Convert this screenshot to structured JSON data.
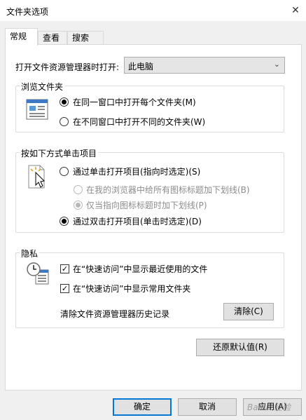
{
  "window": {
    "title": "文件夹选项",
    "close_glyph": "✕"
  },
  "tabs": [
    {
      "label": "常规",
      "active": true
    },
    {
      "label": "查看",
      "active": false
    },
    {
      "label": "搜索",
      "active": false
    }
  ],
  "open_explorer": {
    "label": "打开文件资源管理器时打开:",
    "value": "此电脑",
    "arrow": "⌄"
  },
  "browse": {
    "title": "浏览文件夹",
    "options": [
      {
        "label": "在同一窗口中打开每个文件夹(M)",
        "checked": true
      },
      {
        "label": "在不同窗口中打开不同的文件夹(W)",
        "checked": false
      }
    ]
  },
  "click": {
    "title": "按如下方式单击项目",
    "single": {
      "label": "通过单击打开项目(指向时选定)(S)",
      "checked": false
    },
    "underline_all": {
      "label": "在我的浏览器中给所有图标标题加下划线(B)",
      "checked": false,
      "disabled": true
    },
    "underline_hover": {
      "label": "仅当指向图标标题时加下划线(P)",
      "checked": true,
      "disabled": true
    },
    "double": {
      "label": "通过双击打开项目(单击时选定)(D)",
      "checked": true
    }
  },
  "privacy": {
    "title": "隐私",
    "recent_files": {
      "label": "在“快速访问”中显示最近使用的文件",
      "checked": true
    },
    "frequent_folders": {
      "label": "在“快速访问”中显示常用文件夹",
      "checked": true
    },
    "clear_label": "清除文件资源管理器历史记录",
    "clear_button": "清除(C)",
    "check_glyph": "✓"
  },
  "restore_button": "还原默认值(R)",
  "footer": {
    "ok": "确定",
    "cancel": "取消",
    "apply": "应用(A)"
  },
  "watermark": "Baidu 经验",
  "colors": {
    "accent": "#0078d7",
    "panel_bg": "#ffffff",
    "window_bg": "#f0f0f0"
  },
  "icons": [
    "close-icon",
    "combo-arrow-icon",
    "folder-window-icon",
    "click-cursor-icon",
    "privacy-clock-icon"
  ]
}
